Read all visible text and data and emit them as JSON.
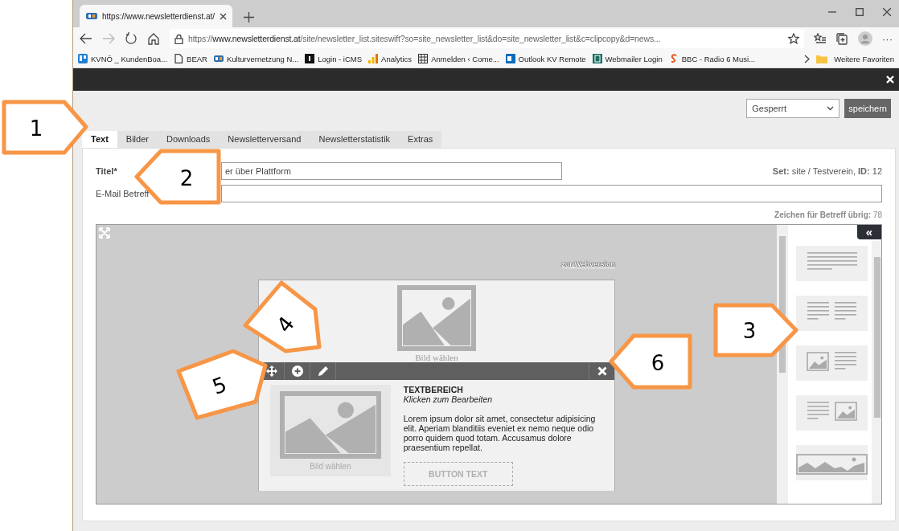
{
  "browser": {
    "tab_title": "https://www.newsletterdienst.at/",
    "nav": [
      {
        "kind": "back",
        "disabled": false
      },
      {
        "kind": "forward",
        "disabled": true
      },
      {
        "kind": "refresh",
        "disabled": false
      },
      {
        "kind": "home",
        "disabled": false
      }
    ],
    "url": "https://**www.newsletterdienst.at**/site/newsletter_list.siteswift?so=site_newsletter_list&do=site_newsletter_list&c=clipcopy&d=news...",
    "more_menu": "···",
    "bookmarks": [
      {
        "label": "KVNÖ _ KundenBoa..."
      },
      {
        "label": "BEAR"
      },
      {
        "label": "Kulturvernetzung N..."
      },
      {
        "label": "Login - iCMS"
      },
      {
        "label": "Analytics"
      },
      {
        "label": "Anmelden ‹ Come..."
      },
      {
        "label": "Outlook KV Remote"
      },
      {
        "label": "Webmailer Login"
      },
      {
        "label": "BBC - Radio 6 Musi..."
      }
    ],
    "more_favorites": "Weitere Favoriten"
  },
  "app": {
    "status_select": "Gesperrt",
    "save_button": "speichern",
    "tabs": [
      {
        "label": "Text",
        "selected": true
      },
      {
        "label": "Bilder",
        "selected": false
      },
      {
        "label": "Downloads",
        "selected": false
      },
      {
        "label": "Newsletterversand",
        "selected": false
      },
      {
        "label": "Newsletterstatistik",
        "selected": false
      },
      {
        "label": "Extras",
        "selected": false
      }
    ],
    "fields": [
      {
        "label": "Titel*",
        "bold": true,
        "value": "er über Plattform",
        "info": "**Set:** site / Testverein, **ID:** 12"
      },
      {
        "label": "E-Mail Betreff",
        "bold": false
      }
    ],
    "chars_left": "**Zeichen für Betreff übrig:** 78",
    "editor": {
      "webversion_link": "zur Webversion",
      "top_image_caption": "Bild wählen",
      "block": {
        "image_caption": "Bild wählen",
        "heading": "TEXTBEREICH",
        "subheading": "Klicken zum Bearbeiten",
        "body": "Lorem ipsum dolor sit amet, consectetur adipisicing elit. Aperiam blanditiis eveniet ex nemo neque odio porro quidem quod totam. Accusamus dolore praesentium repellat.",
        "button": "BUTTON TEXT"
      },
      "panel_toggle": "«",
      "layouts": [
        {
          "kind": "text"
        },
        {
          "kind": "two-columns"
        },
        {
          "kind": "image-text"
        },
        {
          "kind": "text-image"
        },
        {
          "kind": "banner"
        }
      ]
    }
  },
  "callouts": [
    {
      "number": "1"
    },
    {
      "number": "2"
    },
    {
      "number": "3"
    },
    {
      "number": "4"
    },
    {
      "number": "5"
    },
    {
      "number": "6"
    }
  ]
}
